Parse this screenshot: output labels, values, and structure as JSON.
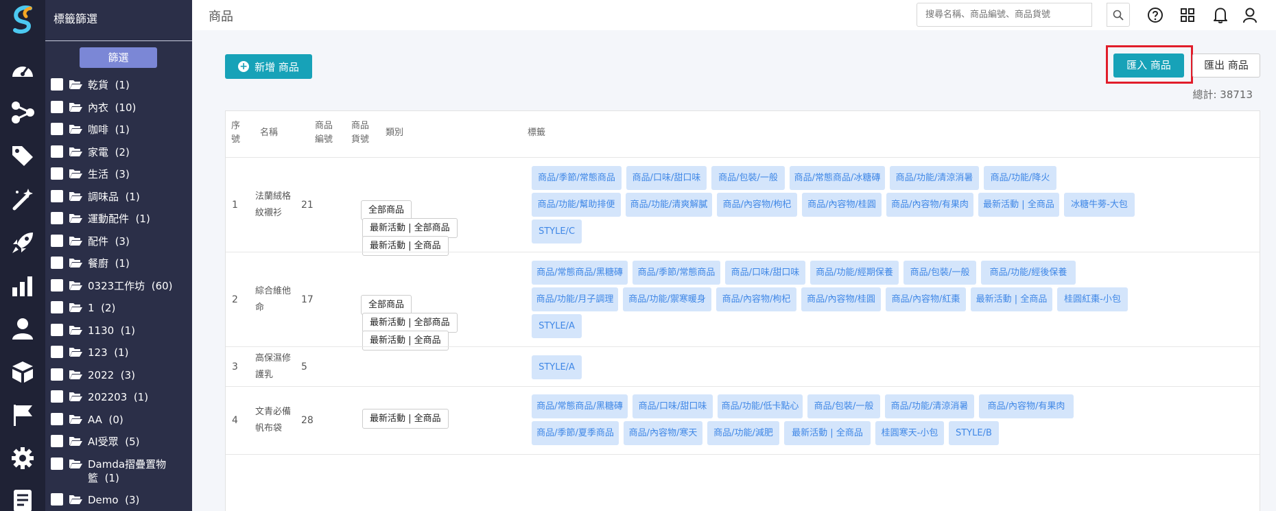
{
  "sidebar": {
    "title": "標籤篩選",
    "filter_button": "篩選",
    "tags": [
      {
        "name": "乾貨",
        "count": "(1)"
      },
      {
        "name": "內衣",
        "count": "(10)"
      },
      {
        "name": "咖啡",
        "count": "(1)"
      },
      {
        "name": "家電",
        "count": "(2)"
      },
      {
        "name": "生活",
        "count": "(3)"
      },
      {
        "name": "調味品",
        "count": "(1)"
      },
      {
        "name": "運動配件",
        "count": "(1)"
      },
      {
        "name": "配件",
        "count": "(3)"
      },
      {
        "name": "餐廚",
        "count": "(1)"
      },
      {
        "name": "0323工作坊",
        "count": "(60)"
      },
      {
        "name": "1",
        "count": "(2)"
      },
      {
        "name": "1130",
        "count": "(1)"
      },
      {
        "name": "123",
        "count": "(1)"
      },
      {
        "name": "2022",
        "count": "(3)"
      },
      {
        "name": "202203",
        "count": "(1)"
      },
      {
        "name": "AA",
        "count": "(0)"
      },
      {
        "name": "AI受眾",
        "count": "(5)"
      },
      {
        "name": "Damda摺疊置物籃",
        "count": "(1)"
      },
      {
        "name": "Demo",
        "count": "(3)"
      }
    ]
  },
  "header": {
    "title": "商品",
    "search_placeholder": "搜尋名稱、商品編號、商品貨號"
  },
  "toolbar": {
    "add_label": "新增 商品",
    "import_label": "匯入 商品",
    "export_label": "匯出 商品",
    "total": "總計: 38713"
  },
  "table": {
    "headers": {
      "seq": [
        "序",
        "號"
      ],
      "name": "名稱",
      "code": [
        "商品",
        "編號"
      ],
      "sku": [
        "商品",
        "貨號"
      ],
      "category": "類別",
      "tags": "標籤"
    },
    "rows": [
      {
        "seq": "1",
        "name": [
          "法蘭絨格",
          "紋襯衫"
        ],
        "code": "21",
        "categories": [
          "全部商品",
          "最新活動 | 全部商品",
          "最新活動 | 全商品"
        ],
        "tags": [
          "商品/季節/常態商品",
          "商品/口味/甜口味",
          "商品/包裝/一般",
          "商品/常態商品/冰糖磚",
          "商品/功能/清涼消暑",
          "商品/功能/降火",
          "商品/功能/幫助排便",
          "商品/功能/清爽解膩",
          "商品/內容物/枸杞",
          "商品/內容物/桂圓",
          "商品/內容物/有果肉",
          "最新活動 | 全商品",
          "冰糖牛蒡-大包",
          "STYLE/C"
        ]
      },
      {
        "seq": "2",
        "name": [
          "綜合維他",
          "命"
        ],
        "code": "17",
        "categories": [
          "全部商品",
          "最新活動 | 全部商品",
          "最新活動 | 全商品"
        ],
        "tags": [
          "商品/常態商品/黑糖磚",
          "商品/季節/常態商品",
          "商品/口味/甜口味",
          "商品/功能/經期保養",
          "商品/包裝/一般",
          "商品/功能/經後保養",
          "商品/功能/月子調理",
          "商品/功能/禦寒暖身",
          "商品/內容物/枸杞",
          "商品/內容物/桂圓",
          "商品/內容物/紅棗",
          "最新活動 | 全商品",
          "桂圓紅棗-小包",
          "STYLE/A"
        ]
      },
      {
        "seq": "3",
        "name": [
          "高保濕修",
          "護乳"
        ],
        "code": "5",
        "categories": [],
        "tags": [
          "STYLE/A"
        ]
      },
      {
        "seq": "4",
        "name": [
          "文青必備",
          "帆布袋"
        ],
        "code": "28",
        "categories": [
          "最新活動 | 全商品"
        ],
        "tags": [
          "商品/常態商品/黑糖磚",
          "商品/口味/甜口味",
          "商品/功能/低卡點心",
          "商品/包裝/一般",
          "商品/功能/清涼消暑",
          "商品/內容物/有果肉",
          "商品/季節/夏季商品",
          "商品/內容物/寒天",
          "商品/功能/減肥",
          "最新活動 | 全商品",
          "桂圓寒天-小包",
          "STYLE/B"
        ]
      }
    ]
  },
  "colors": {
    "rail": "#1f2235",
    "panel": "#2b2f48",
    "accent": "#17a2b8",
    "filter_button": "#7b87d6",
    "chip_bg": "#d4e5fb",
    "chip_text": "#3f87e6",
    "highlight": "#e11d2a"
  },
  "icons": {
    "rail": [
      "speedometer-icon",
      "share-icon",
      "tag-icon",
      "magic-wand-icon",
      "rocket-icon",
      "bar-chart-icon",
      "user-icon",
      "box-icon",
      "flag-icon",
      "gear-icon",
      "document-icon"
    ],
    "header": [
      "search-icon",
      "help-icon",
      "apps-grid-icon",
      "bell-icon",
      "account-icon"
    ]
  }
}
